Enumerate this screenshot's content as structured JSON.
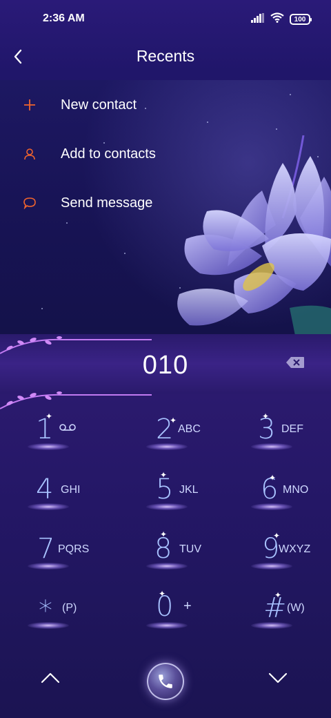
{
  "status_bar": {
    "time": "2:36 AM",
    "battery": "100"
  },
  "header": {
    "title": "Recents"
  },
  "menu": {
    "items": [
      {
        "label": "New contact",
        "icon": "plus-icon"
      },
      {
        "label": "Add to contacts",
        "icon": "person-icon"
      },
      {
        "label": "Send message",
        "icon": "message-bubble-icon"
      }
    ]
  },
  "dialer": {
    "number": "010",
    "keys": [
      {
        "digit": "1",
        "letters": ""
      },
      {
        "digit": "2",
        "letters": "ABC"
      },
      {
        "digit": "3",
        "letters": "DEF"
      },
      {
        "digit": "4",
        "letters": "GHI"
      },
      {
        "digit": "5",
        "letters": "JKL"
      },
      {
        "digit": "6",
        "letters": "MNO"
      },
      {
        "digit": "7",
        "letters": "PQRS"
      },
      {
        "digit": "8",
        "letters": "TUV"
      },
      {
        "digit": "9",
        "letters": "WXYZ"
      },
      {
        "digit": "*",
        "letters": "(P)"
      },
      {
        "digit": "0",
        "letters": "+"
      },
      {
        "digit": "#",
        "letters": "(W)"
      }
    ]
  },
  "colors": {
    "accent": "#f0642d",
    "digit": "#a8c2ff",
    "background": "#1b1550"
  }
}
